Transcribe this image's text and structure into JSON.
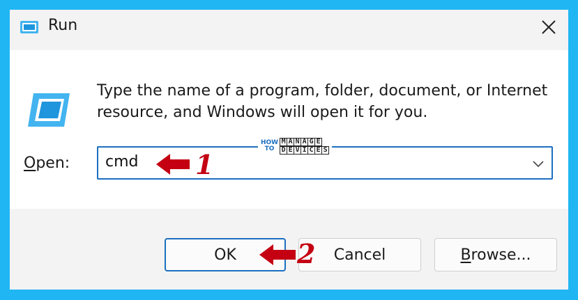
{
  "window": {
    "title": "Run",
    "close_icon": "close-icon"
  },
  "content": {
    "description": "Type the name of a program, folder, document, or Internet resource, and Windows will open it for you.",
    "open_label_accel": "O",
    "open_label_rest": "pen:",
    "combo_value": "cmd"
  },
  "watermark": {
    "how": "HOW",
    "to": "TO",
    "line1": "MANAGE",
    "line2": "DEVICES"
  },
  "annotations": {
    "step1": "1",
    "step2": "2",
    "color": "#c40012"
  },
  "buttons": {
    "ok": "OK",
    "cancel": "Cancel",
    "browse_accel": "B",
    "browse_rest": "rowse..."
  },
  "colors": {
    "background": "#1fb6f3",
    "accent": "#1b6fc0"
  }
}
